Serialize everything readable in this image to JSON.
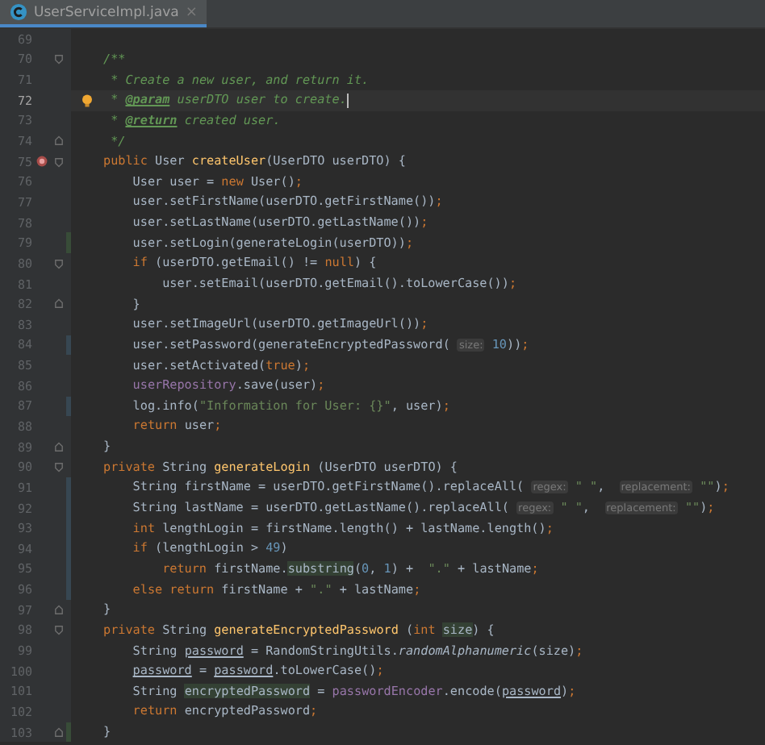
{
  "tab": {
    "title": "UserServiceImpl.java",
    "close": "×",
    "selected": true
  },
  "lines": [
    {
      "number": "69"
    },
    {
      "number": "70",
      "fold_start": true,
      "tokens": [
        {
          "kind": "cmt",
          "t": "/**"
        }
      ]
    },
    {
      "number": "71",
      "tokens": [
        {
          "kind": "cmt",
          "t": " * Create a new user, and return it."
        }
      ]
    },
    {
      "number": "72",
      "current": true,
      "bulb": true,
      "tokens": [
        {
          "kind": "cmt",
          "t": " * "
        },
        {
          "kind": "tag",
          "t": "@param"
        },
        {
          "kind": "cmt",
          "t": " userDTO user to create."
        }
      ]
    },
    {
      "number": "73",
      "tokens": [
        {
          "kind": "cmt",
          "t": " * "
        },
        {
          "kind": "tag",
          "t": "@return"
        },
        {
          "kind": "cmt",
          "t": " created user."
        }
      ]
    },
    {
      "number": "74",
      "fold_end": true,
      "tokens": [
        {
          "kind": "cmt",
          "t": " */"
        }
      ]
    },
    {
      "number": "75",
      "fold_start": true,
      "method_marker": true,
      "tokens": [
        {
          "kind": "kw",
          "t": "public"
        },
        {
          "kind": "p",
          "t": " User "
        },
        {
          "kind": "fn",
          "t": "createUser"
        },
        {
          "kind": "p",
          "t": "(UserDTO userDTO) {"
        }
      ]
    },
    {
      "number": "76",
      "tokens": [
        {
          "kind": "p",
          "t": "    User user = "
        },
        {
          "kind": "kw",
          "t": "new"
        },
        {
          "kind": "p",
          "t": " User()"
        },
        {
          "kind": "kw",
          "t": ";"
        }
      ]
    },
    {
      "number": "77",
      "tokens": [
        {
          "kind": "p",
          "t": "    user.setFirstName(userDTO.getFirstName())"
        },
        {
          "kind": "kw",
          "t": ";"
        }
      ]
    },
    {
      "number": "78",
      "tokens": [
        {
          "kind": "p",
          "t": "    user.setLastName(userDTO.getLastName())"
        },
        {
          "kind": "kw",
          "t": ";"
        }
      ]
    },
    {
      "number": "79",
      "added": true,
      "tokens": [
        {
          "kind": "p",
          "t": "    user.setLogin(generateLogin(userDTO))"
        },
        {
          "kind": "kw",
          "t": ";"
        }
      ]
    },
    {
      "number": "80",
      "fold_start": true,
      "tokens": [
        {
          "kind": "kw",
          "t": "    if"
        },
        {
          "kind": "p",
          "t": " (userDTO.getEmail() != "
        },
        {
          "kind": "kw",
          "t": "null"
        },
        {
          "kind": "p",
          "t": ") {"
        }
      ]
    },
    {
      "number": "81",
      "tokens": [
        {
          "kind": "p",
          "t": "        user.setEmail(userDTO.getEmail().toLowerCase())"
        },
        {
          "kind": "kw",
          "t": ";"
        }
      ]
    },
    {
      "number": "82",
      "fold_end": true,
      "tokens": [
        {
          "kind": "p",
          "t": "    }"
        }
      ]
    },
    {
      "number": "83",
      "tokens": [
        {
          "kind": "p",
          "t": "    user.setImageUrl(userDTO.getImageUrl())"
        },
        {
          "kind": "kw",
          "t": ";"
        }
      ]
    },
    {
      "number": "84",
      "modified": true,
      "tokens": [
        {
          "kind": "p",
          "t": "    user.setPassword(generateEncryptedPassword( "
        },
        {
          "kind": "hint",
          "t": "size:"
        },
        {
          "kind": "num",
          "t": " 10"
        },
        {
          "kind": "p",
          "t": "))"
        },
        {
          "kind": "kw",
          "t": ";"
        }
      ]
    },
    {
      "number": "85",
      "tokens": [
        {
          "kind": "p",
          "t": "    user.setActivated("
        },
        {
          "kind": "kw",
          "t": "true"
        },
        {
          "kind": "p",
          "t": ")"
        },
        {
          "kind": "kw",
          "t": ";"
        }
      ]
    },
    {
      "number": "86",
      "tokens": [
        {
          "kind": "field",
          "t": "    userRepository"
        },
        {
          "kind": "p",
          "t": ".save(user)"
        },
        {
          "kind": "kw",
          "t": ";"
        }
      ]
    },
    {
      "number": "87",
      "modified": true,
      "tokens": [
        {
          "kind": "p",
          "t": "    log.info("
        },
        {
          "kind": "str",
          "t": "\"Information for User: {}\""
        },
        {
          "kind": "p",
          "t": ", user)"
        },
        {
          "kind": "kw",
          "t": ";"
        }
      ]
    },
    {
      "number": "88",
      "tokens": [
        {
          "kind": "kw",
          "t": "    return"
        },
        {
          "kind": "p",
          "t": " user"
        },
        {
          "kind": "kw",
          "t": ";"
        }
      ]
    },
    {
      "number": "89",
      "fold_end": true,
      "tokens": [
        {
          "kind": "p",
          "t": "}"
        }
      ]
    },
    {
      "number": "90",
      "fold_start": true,
      "tokens": [
        {
          "kind": "kw",
          "t": "private"
        },
        {
          "kind": "p",
          "t": " String "
        },
        {
          "kind": "fn",
          "t": "generateLogin"
        },
        {
          "kind": "p",
          "t": " (UserDTO userDTO) {"
        }
      ]
    },
    {
      "number": "91",
      "modified": true,
      "tokens": [
        {
          "kind": "p",
          "t": "    String firstName = userDTO.getFirstName().replaceAll( "
        },
        {
          "kind": "hint",
          "t": "regex:"
        },
        {
          "kind": "str",
          "t": " \" \""
        },
        {
          "kind": "p",
          "t": ",  "
        },
        {
          "kind": "hint",
          "t": "replacement:"
        },
        {
          "kind": "str",
          "t": " \"\""
        },
        {
          "kind": "p",
          "t": ")"
        },
        {
          "kind": "kw",
          "t": ";"
        }
      ]
    },
    {
      "number": "92",
      "modified": true,
      "tokens": [
        {
          "kind": "p",
          "t": "    String lastName = userDTO.getLastName().replaceAll( "
        },
        {
          "kind": "hint",
          "t": "regex:"
        },
        {
          "kind": "str",
          "t": " \" \""
        },
        {
          "kind": "p",
          "t": ",  "
        },
        {
          "kind": "hint",
          "t": "replacement:"
        },
        {
          "kind": "str",
          "t": " \"\""
        },
        {
          "kind": "p",
          "t": ")"
        },
        {
          "kind": "kw",
          "t": ";"
        }
      ]
    },
    {
      "number": "93",
      "modified": true,
      "tokens": [
        {
          "kind": "kw",
          "t": "    int"
        },
        {
          "kind": "p",
          "t": " lengthLogin = firstName.length() + lastName.length()"
        },
        {
          "kind": "kw",
          "t": ";"
        }
      ]
    },
    {
      "number": "94",
      "modified": true,
      "tokens": [
        {
          "kind": "kw",
          "t": "    if"
        },
        {
          "kind": "p",
          "t": " (lengthLogin > "
        },
        {
          "kind": "num",
          "t": "49"
        },
        {
          "kind": "p",
          "t": ")"
        }
      ]
    },
    {
      "number": "95",
      "modified": true,
      "tokens": [
        {
          "kind": "kw",
          "t": "        return"
        },
        {
          "kind": "p",
          "t": " firstName."
        },
        {
          "kind": "hl",
          "t": "substring"
        },
        {
          "kind": "p",
          "t": "("
        },
        {
          "kind": "num",
          "t": "0"
        },
        {
          "kind": "p",
          "t": ", "
        },
        {
          "kind": "num",
          "t": "1"
        },
        {
          "kind": "p",
          "t": ") +  "
        },
        {
          "kind": "str",
          "t": "\".\""
        },
        {
          "kind": "p",
          "t": " + lastName"
        },
        {
          "kind": "kw",
          "t": ";"
        }
      ]
    },
    {
      "number": "96",
      "modified": true,
      "tokens": [
        {
          "kind": "kw",
          "t": "    else return"
        },
        {
          "kind": "p",
          "t": " firstName + "
        },
        {
          "kind": "str",
          "t": "\".\""
        },
        {
          "kind": "p",
          "t": " + lastName"
        },
        {
          "kind": "kw",
          "t": ";"
        }
      ]
    },
    {
      "number": "97",
      "fold_end": true,
      "tokens": [
        {
          "kind": "p",
          "t": "}"
        }
      ]
    },
    {
      "number": "98",
      "fold_start": true,
      "tokens": [
        {
          "kind": "kw",
          "t": "private"
        },
        {
          "kind": "p",
          "t": " String "
        },
        {
          "kind": "fn",
          "t": "generateEncryptedPassword"
        },
        {
          "kind": "p",
          "t": " ("
        },
        {
          "kind": "kw",
          "t": "int "
        },
        {
          "kind": "hl",
          "t": "size"
        },
        {
          "kind": "p",
          "t": ") {"
        }
      ]
    },
    {
      "number": "99",
      "tokens": [
        {
          "kind": "p",
          "t": "    String "
        },
        {
          "kind": "ul",
          "t": "password"
        },
        {
          "kind": "p",
          "t": " = RandomStringUtils."
        },
        {
          "kind": "ital",
          "t": "randomAlphanumeric"
        },
        {
          "kind": "p",
          "t": "(size)"
        },
        {
          "kind": "kw",
          "t": ";"
        }
      ]
    },
    {
      "number": "100",
      "tokens": [
        {
          "kind": "ul",
          "t": "    password"
        },
        {
          "kind": "p",
          "t": " = "
        },
        {
          "kind": "ul",
          "t": "password"
        },
        {
          "kind": "p",
          "t": ".toLowerCase()"
        },
        {
          "kind": "kw",
          "t": ";"
        }
      ]
    },
    {
      "number": "101",
      "tokens": [
        {
          "kind": "p",
          "t": "    String "
        },
        {
          "kind": "hl",
          "t": "encryptedPassword"
        },
        {
          "kind": "p",
          "t": " = "
        },
        {
          "kind": "field",
          "t": "passwordEncoder"
        },
        {
          "kind": "p",
          "t": ".encode("
        },
        {
          "kind": "ul",
          "t": "password"
        },
        {
          "kind": "p",
          "t": ")"
        },
        {
          "kind": "kw",
          "t": ";"
        }
      ]
    },
    {
      "number": "102",
      "tokens": [
        {
          "kind": "kw",
          "t": "    return"
        },
        {
          "kind": "p",
          "t": " encryptedPassword"
        },
        {
          "kind": "kw",
          "t": ";"
        }
      ]
    },
    {
      "number": "103",
      "fold_end": true,
      "added": true,
      "tokens": [
        {
          "kind": "p",
          "t": "}"
        }
      ]
    }
  ]
}
